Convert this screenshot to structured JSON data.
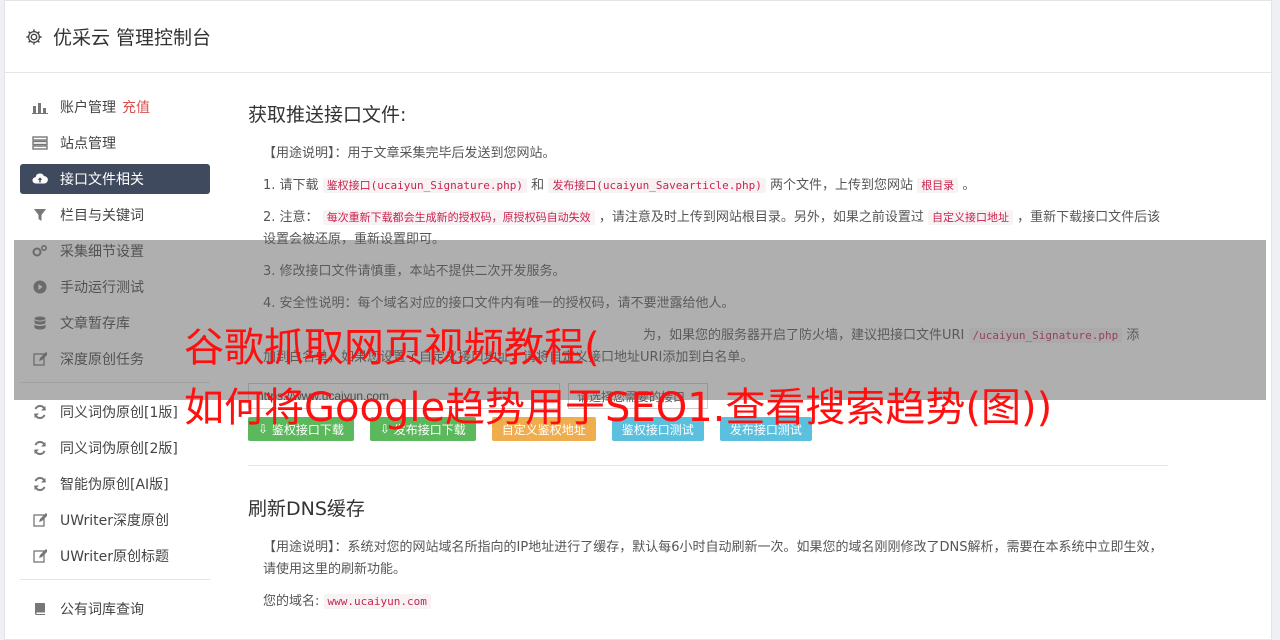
{
  "header": {
    "title": "优采云 管理控制台",
    "icon": "gear-icon"
  },
  "sidebar": {
    "group1": [
      {
        "label": "账户管理",
        "tag": "充值",
        "icon": "bar-chart-icon"
      },
      {
        "label": "站点管理",
        "icon": "server-icon"
      },
      {
        "label": "接口文件相关",
        "icon": "cloud-upload-icon",
        "active": true
      },
      {
        "label": "栏目与关键词",
        "icon": "filter-icon"
      },
      {
        "label": "采集细节设置",
        "icon": "cogs-icon"
      },
      {
        "label": "手动运行测试",
        "icon": "play-circle-icon"
      },
      {
        "label": "文章暂存库",
        "icon": "database-icon"
      },
      {
        "label": "深度原创任务",
        "icon": "edit-icon"
      }
    ],
    "group2": [
      {
        "label": "同义词伪原创[1版]",
        "icon": "refresh-icon"
      },
      {
        "label": "同义词伪原创[2版]",
        "icon": "refresh-icon"
      },
      {
        "label": "智能伪原创[AI版]",
        "icon": "refresh-icon"
      },
      {
        "label": "UWriter深度原创",
        "icon": "edit-icon"
      },
      {
        "label": "UWriter原创标题",
        "icon": "edit-icon"
      }
    ],
    "group3": [
      {
        "label": "公有词库查询",
        "icon": "book-icon"
      }
    ]
  },
  "main": {
    "section1_title": "获取推送接口文件:",
    "usage_label": "【用途说明】",
    "usage_text": "：用于文章采集完毕后发送到您网站。",
    "item1_a": "1. 请下载",
    "item1_code1": "鉴权接口(ucaiyun_Signature.php)",
    "item1_b": "和",
    "item1_code2": "发布接口(ucaiyun_Savearticle.php)",
    "item1_c": "两个文件，上传到您网站",
    "item1_code3": "根目录",
    "item1_d": "。",
    "item2_a": "2. 注意：",
    "item2_code1": "每次重新下载都会生成新的授权码，原授权码自动失效",
    "item2_b": "，请注意及时上传到网站根目录。另外，如果之前设置过",
    "item2_code2": "自定义接口地址",
    "item2_c": "，重新下载接口文件后该设置会被还原，重新设置即可。",
    "item3": "3. 修改接口文件请慎重，本站不提供二次开发服务。",
    "item4": "4. 安全性说明：每个域名对应的接口文件内有唯一的授权码，请不要泄露给他人。",
    "item5_a": "为，如果您的服务器开启了防火墙，建议把接口文件URI",
    "item5_code": "/ucaiyun_Signature.php",
    "item5_b": "添",
    "item5_c": "加到白名单，如果您设置了自定义接口地址，请将自定义接口地址URI添加到白名单。",
    "url_value": "https://www.ucaiyun.com",
    "select_value": "请选择您需要的接口",
    "buttons": {
      "sig_download": "鉴权接口下载",
      "pub_download": "发布接口下载",
      "custom_sig": "自定义鉴权地址",
      "sig_test": "鉴权接口测试",
      "pub_test": "发布接口测试"
    },
    "section2_title": "刷新DNS缓存",
    "dns_usage_text": "：系统对您的网站域名所指向的IP地址进行了缓存，默认每6小时自动刷新一次。如果您的域名刚刚修改了DNS解析，需要在本系统中立即生效，请使用这里的刷新功能。",
    "domain_label": "您的域名:",
    "domain_value": "www.ucaiyun.com"
  },
  "overlay": {
    "line1": "谷歌抓取网页视频教程(",
    "line2": "如何将Google趋势用于SEO1.查看搜索趋势(图))"
  }
}
